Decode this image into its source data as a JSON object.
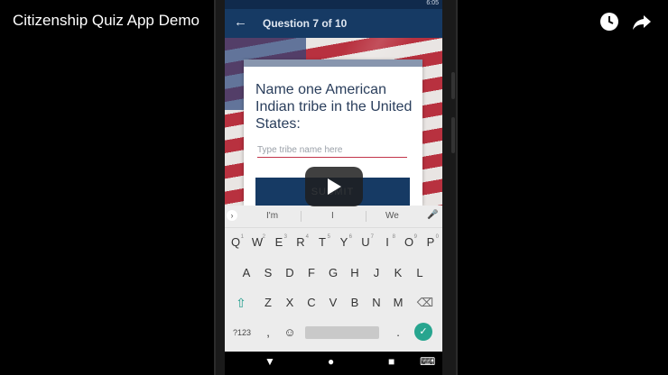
{
  "video": {
    "title": "Citizenship Quiz App Demo",
    "icons": [
      "watch-later-icon",
      "share-icon"
    ]
  },
  "status_bar": {
    "time": "6:05"
  },
  "app_bar": {
    "back_icon": "←",
    "title": "Question 7 of 10"
  },
  "card": {
    "question": "Name one American Indian tribe in the United States:",
    "answer_placeholder": "Type tribe name here",
    "answer_value": "",
    "submit_label": "SUBMIT"
  },
  "keyboard": {
    "suggestions": [
      "I'm",
      "I",
      "We"
    ],
    "row1": [
      "Q",
      "W",
      "E",
      "R",
      "T",
      "Y",
      "U",
      "I",
      "O",
      "P"
    ],
    "row1_digits": [
      "1",
      "2",
      "3",
      "4",
      "5",
      "6",
      "7",
      "8",
      "9",
      "0"
    ],
    "row2": [
      "A",
      "S",
      "D",
      "F",
      "G",
      "H",
      "J",
      "K",
      "L"
    ],
    "row3": [
      "Z",
      "X",
      "C",
      "V",
      "B",
      "N",
      "M"
    ],
    "symbols_label": "?123",
    "comma": ",",
    "emoji": "☺",
    "period": ".",
    "shift_glyph": "⇧",
    "delete_glyph": "⌫",
    "enter_glyph": "✓",
    "mic_glyph": "↓"
  },
  "nav_bar": {
    "back": "▼",
    "home": "●",
    "recents": "■",
    "keyboard": "⌨"
  },
  "colors": {
    "app_bar": "#163a64",
    "accent": "#c2344a",
    "enter_key": "#27a58f"
  }
}
